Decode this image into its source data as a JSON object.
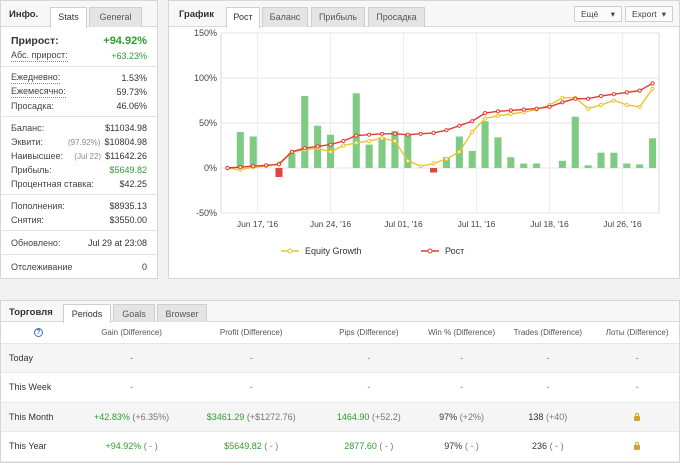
{
  "info": {
    "title": "Инфо.",
    "tabs": [
      "Stats",
      "General"
    ],
    "gain_label": "Прирост:",
    "gain_value": "+94.92%",
    "abs_label": "Абс. прирост:",
    "abs_value": "+63.23%",
    "daily_label": "Ежедневно:",
    "daily_value": "1.53%",
    "monthly_label": "Ежемесячно:",
    "monthly_value": "59.73%",
    "dd_label": "Просадка:",
    "dd_value": "46.06%",
    "balance_label": "Баланс:",
    "balance_value": "$11034.98",
    "equity_label": "Эквити:",
    "equity_sub": "(97.92%)",
    "equity_value": "$10804.98",
    "highest_label": "Наивысшее:",
    "highest_sub": "(Jul 22)",
    "highest_value": "$11642.26",
    "profit_label": "Прибыль:",
    "profit_value": "$5649.82",
    "interest_label": "Процентная ставка:",
    "interest_value": "$42.25",
    "deposits_label": "Пополнения:",
    "deposits_value": "$8935.13",
    "withdrawals_label": "Снятия:",
    "withdrawals_value": "$3550.00",
    "updated_label": "Обновлено:",
    "updated_value": "Jul 29 at 23:08",
    "tracking_label": "Отслеживание",
    "tracking_value": "0"
  },
  "chart_panel": {
    "title": "График",
    "tabs": [
      "Рост",
      "Баланс",
      "Прибыль",
      "Просадка"
    ],
    "more_button": "Ещё",
    "export_button": "Export"
  },
  "chart_data": {
    "type": "line",
    "y_ticks": [
      "150%",
      "100%",
      "50%",
      "0%",
      "-50%"
    ],
    "ylim": [
      -50,
      150
    ],
    "x_ticks": [
      "Jun 17, '16",
      "Jun 24, '16",
      "Jul 01, '16",
      "Jul 11, '16",
      "Jul 18, '16",
      "Jul 26, '16"
    ],
    "grid": true,
    "legend_position": "bottom",
    "series": [
      {
        "name": "Equity Growth",
        "color": "#e8c42a",
        "values": [
          0,
          -2,
          1,
          2,
          5,
          18,
          20,
          22,
          18,
          25,
          28,
          30,
          33,
          30,
          8,
          2,
          5,
          10,
          18,
          40,
          55,
          58,
          60,
          62,
          65,
          70,
          78,
          78,
          66,
          70,
          75,
          70,
          68,
          88
        ]
      },
      {
        "name": "Рост",
        "color": "#e03b2f",
        "values": [
          0,
          1,
          2,
          3,
          4,
          18,
          22,
          24,
          26,
          30,
          36,
          37,
          38,
          38,
          37,
          38,
          39,
          42,
          47,
          52,
          61,
          63,
          64,
          65,
          66,
          68,
          73,
          77,
          77,
          80,
          82,
          84,
          86,
          94
        ]
      }
    ],
    "bars": {
      "values": [
        0,
        40,
        35,
        0,
        -10,
        17,
        80,
        47,
        37,
        0,
        83,
        26,
        34,
        41,
        38,
        0,
        -5,
        12,
        35,
        19,
        52,
        34,
        12,
        5,
        5,
        0,
        8,
        57,
        3,
        17,
        17,
        5,
        4,
        33
      ],
      "pos_color": "#7fcb84",
      "neg_color": "#e04545"
    }
  },
  "trade": {
    "title": "Торговля",
    "tabs": [
      "Periods",
      "Goals",
      "Browser"
    ],
    "help_icon": "?",
    "headers": [
      "Gain (Difference)",
      "Profit (Difference)",
      "Pips (Difference)",
      "Win % (Difference)",
      "Trades (Difference)",
      "Лоты (Difference)"
    ],
    "rows": [
      {
        "label": "Today",
        "gain": "-",
        "gain_diff": "",
        "profit": "-",
        "profit_diff": "",
        "pips": "-",
        "pips_diff": "",
        "win": "-",
        "win_diff": "",
        "trades": "-",
        "trades_diff": "",
        "lots": "-",
        "locked": false
      },
      {
        "label": "This Week",
        "gain": "-",
        "gain_diff": "",
        "profit": "-",
        "profit_diff": "",
        "pips": "-",
        "pips_diff": "",
        "win": "-",
        "win_diff": "",
        "trades": "-",
        "trades_diff": "",
        "lots": "-",
        "locked": false
      },
      {
        "label": "This Month",
        "gain": "+42.83%",
        "gain_diff": "(+6.35%)",
        "profit": "$3461.29",
        "profit_diff": "(+$1272.76)",
        "pips": "1464.90",
        "pips_diff": "(+52.2)",
        "win": "97%",
        "win_diff": "(+2%)",
        "trades": "138",
        "trades_diff": "(+40)",
        "lots": "",
        "locked": true
      },
      {
        "label": "This Year",
        "gain": "+94.92%",
        "gain_diff": "( - )",
        "profit": "$5649.82",
        "profit_diff": "( - )",
        "pips": "2877.60",
        "pips_diff": "( - )",
        "win": "97%",
        "win_diff": "( - )",
        "trades": "236",
        "trades_diff": "( - )",
        "lots": "",
        "locked": true
      }
    ]
  }
}
